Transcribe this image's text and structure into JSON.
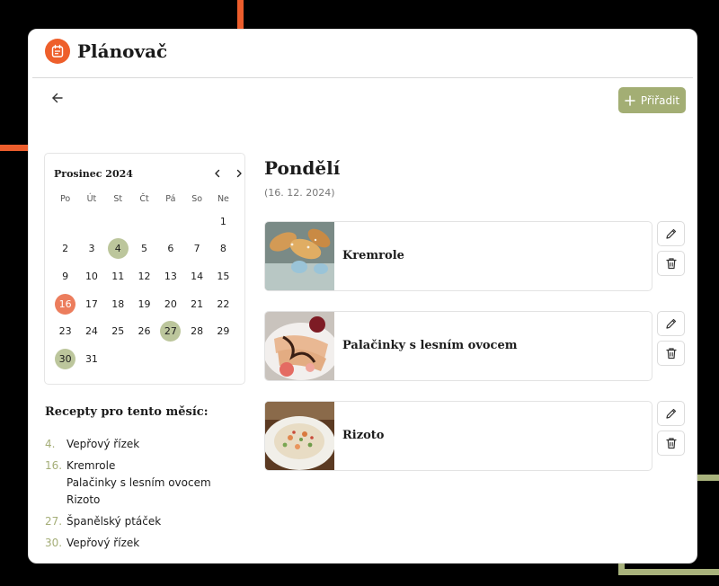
{
  "colors": {
    "accent_orange": "#ec5d2c",
    "accent_green": "#a3ae74",
    "day_highlight_green": "#bcc69c",
    "day_highlight_orange": "#ec7d5d"
  },
  "header": {
    "title": "Plánovač",
    "logo_icon": "calendar-note-icon"
  },
  "toolbar": {
    "back_icon": "arrow-left-icon",
    "assign_label": "Přiřadit",
    "assign_icon": "plus-icon"
  },
  "calendar": {
    "month_label": "Prosinec 2024",
    "weekdays": [
      "Po",
      "Út",
      "St",
      "Čt",
      "Pá",
      "So",
      "Ne"
    ],
    "rows": [
      [
        "",
        "",
        "",
        "",
        "",
        "",
        "1"
      ],
      [
        "2",
        "3",
        "4",
        "5",
        "6",
        "7",
        "8"
      ],
      [
        "9",
        "10",
        "11",
        "12",
        "13",
        "14",
        "15"
      ],
      [
        "16",
        "17",
        "18",
        "19",
        "20",
        "21",
        "22"
      ],
      [
        "23",
        "24",
        "25",
        "26",
        "27",
        "28",
        "29"
      ],
      [
        "30",
        "31",
        "",
        "",
        "",
        "",
        ""
      ]
    ],
    "highlighted_days": [
      "4",
      "27",
      "30"
    ],
    "selected_day": "16"
  },
  "month_recipes": {
    "title": "Recepty pro tento měsíc:",
    "items": [
      {
        "day": "4.",
        "recipes": [
          "Vepřový řízek"
        ]
      },
      {
        "day": "16.",
        "recipes": [
          "Kremrole",
          "Palačinky s lesním ovocem",
          "Rizoto"
        ]
      },
      {
        "day": "27.",
        "recipes": [
          "Španělský ptáček"
        ]
      },
      {
        "day": "30.",
        "recipes": [
          "Vepřový řízek"
        ]
      }
    ]
  },
  "day_view": {
    "title": "Pondělí",
    "date": "(16. 12. 2024)",
    "recipes": [
      {
        "name": "Kremrole"
      },
      {
        "name": "Palačinky s lesním ovocem"
      },
      {
        "name": "Rizoto"
      }
    ]
  }
}
